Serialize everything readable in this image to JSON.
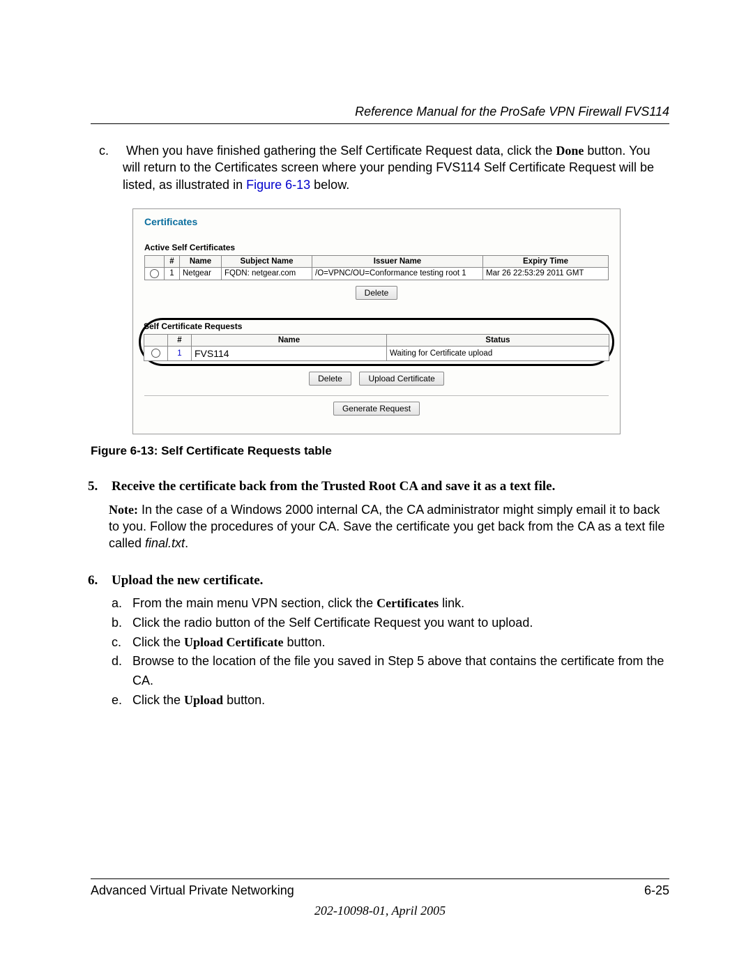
{
  "header": {
    "title": "Reference Manual for the ProSafe VPN Firewall FVS114"
  },
  "para_c": {
    "marker": "c.",
    "t1": "When you have finished gathering the Self Certificate Request data, click the ",
    "b1": "Done",
    "t2": " button. You will return to the Certificates screen where your pending  FVS114  Self Certificate Request will be listed, as illustrated in ",
    "link": "Figure 6-13",
    "t3": " below."
  },
  "shot": {
    "title": "Certificates",
    "active": {
      "heading": "Active Self Certificates",
      "cols": {
        "num": "#",
        "name": "Name",
        "subject": "Subject Name",
        "issuer": "Issuer Name",
        "expiry": "Expiry Time"
      },
      "row": {
        "num": "1",
        "name": "Netgear",
        "subject": "FQDN: netgear.com",
        "issuer": "/O=VPNC/OU=Conformance testing root 1",
        "expiry": "Mar 26 22:53:29 2011 GMT"
      },
      "delete": "Delete"
    },
    "req": {
      "heading": "Self Certificate Requests",
      "cols": {
        "num": "#",
        "name": "Name",
        "status": "Status"
      },
      "row": {
        "num": "1",
        "name": "FVS114",
        "status": "Waiting for Certificate upload"
      },
      "delete": "Delete",
      "upload": "Upload Certificate"
    },
    "gen": "Generate Request"
  },
  "caption": "Figure 6-13: Self Certificate Requests table",
  "step5": {
    "num": "5.",
    "title": "Receive the certificate back from the Trusted Root CA and save it as a text file.",
    "note_b": "Note:",
    "note": " In the case of a Windows 2000 internal CA, the CA administrator might simply email it to back to you. Follow the procedures of your CA. Save the certificate you get back from the CA as a text file called ",
    "note_i": "final.txt",
    "note_end": "."
  },
  "step6": {
    "num": "6.",
    "title": "Upload the new certificate.",
    "a": {
      "m": "a.",
      "t1": "From the main menu VPN section, click the ",
      "b": "Certificates",
      "t2": " link."
    },
    "b": {
      "m": "b.",
      "t": "Click the radio button of the Self Certificate Request you want to upload."
    },
    "c": {
      "m": "c.",
      "t1": "Click the ",
      "b": "Upload Certificate",
      "t2": " button."
    },
    "d": {
      "m": "d.",
      "t": "Browse to the location of the file you saved in Step 5 above that contains the certificate from the CA."
    },
    "e": {
      "m": "e.",
      "t1": "Click the ",
      "b": "Upload",
      "t2": " button."
    }
  },
  "footer": {
    "left": "Advanced Virtual Private Networking",
    "right": "6-25",
    "doc": "202-10098-01, April 2005"
  }
}
